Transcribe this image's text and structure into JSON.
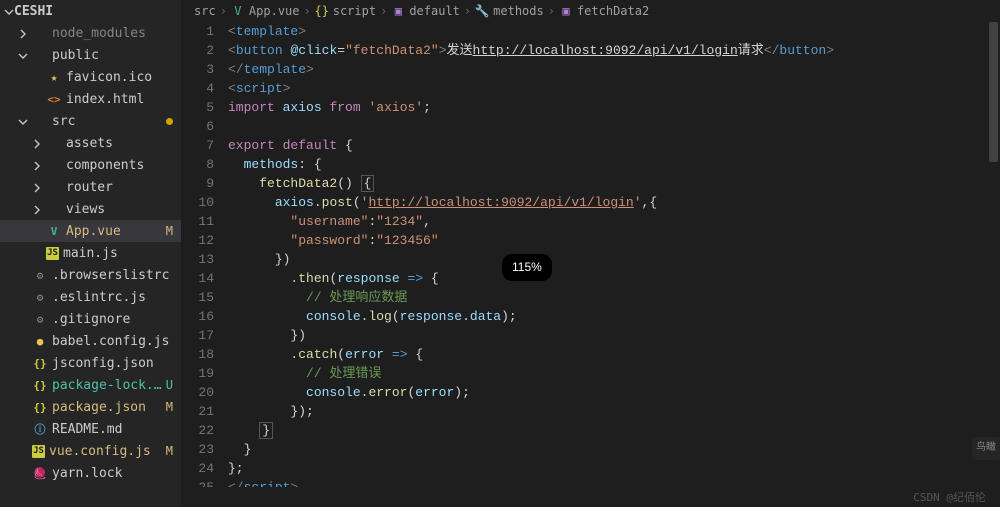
{
  "explorer": {
    "root": "CESHI",
    "items": [
      {
        "indent": 1,
        "arrow": "right",
        "icon": "folder",
        "label": "node_modules",
        "dim": true
      },
      {
        "indent": 1,
        "arrow": "down",
        "icon": "folder",
        "label": "public"
      },
      {
        "indent": 2,
        "arrow": "",
        "icon": "star",
        "label": "favicon.ico",
        "iconColor": "ic-yellow"
      },
      {
        "indent": 2,
        "arrow": "",
        "icon": "html",
        "label": "index.html",
        "iconColor": "ic-orange"
      },
      {
        "indent": 1,
        "arrow": "down",
        "icon": "folder",
        "label": "src",
        "gitDot": true
      },
      {
        "indent": 2,
        "arrow": "right",
        "icon": "folder",
        "label": "assets"
      },
      {
        "indent": 2,
        "arrow": "right",
        "icon": "folder",
        "label": "components"
      },
      {
        "indent": 2,
        "arrow": "right",
        "icon": "folder",
        "label": "router"
      },
      {
        "indent": 2,
        "arrow": "right",
        "icon": "folder",
        "label": "views"
      },
      {
        "indent": 2,
        "arrow": "",
        "icon": "vue",
        "label": "App.vue",
        "iconColor": "ic-green",
        "status": "M",
        "statusClass": "mod",
        "selected": true
      },
      {
        "indent": 2,
        "arrow": "",
        "icon": "js",
        "label": "main.js",
        "iconColor": "ic-js"
      },
      {
        "indent": 1,
        "arrow": "",
        "icon": "gear",
        "label": ".browserslistrc",
        "iconColor": "ic-gear"
      },
      {
        "indent": 1,
        "arrow": "",
        "icon": "gear",
        "label": ".eslintrc.js",
        "iconColor": "ic-gear"
      },
      {
        "indent": 1,
        "arrow": "",
        "icon": "gear",
        "label": ".gitignore",
        "iconColor": "ic-gear"
      },
      {
        "indent": 1,
        "arrow": "",
        "icon": "babel",
        "label": "babel.config.js",
        "iconColor": "ic-yellow"
      },
      {
        "indent": 1,
        "arrow": "",
        "icon": "json",
        "label": "jsconfig.json",
        "iconColor": "ic-json"
      },
      {
        "indent": 1,
        "arrow": "",
        "icon": "json",
        "label": "package-lock.json",
        "iconColor": "ic-json",
        "status": "U",
        "statusClass": ""
      },
      {
        "indent": 1,
        "arrow": "",
        "icon": "json",
        "label": "package.json",
        "iconColor": "ic-json",
        "status": "M",
        "statusClass": "mod"
      },
      {
        "indent": 1,
        "arrow": "",
        "icon": "info",
        "label": "README.md",
        "iconColor": "ic-md"
      },
      {
        "indent": 1,
        "arrow": "",
        "icon": "js",
        "label": "vue.config.js",
        "iconColor": "ic-js",
        "status": "M",
        "statusClass": "mod"
      },
      {
        "indent": 1,
        "arrow": "",
        "icon": "yarn",
        "label": "yarn.lock",
        "iconColor": "ic-blue"
      }
    ]
  },
  "breadcrumb": [
    {
      "icon": "",
      "label": "src"
    },
    {
      "icon": "vue",
      "label": "App.vue"
    },
    {
      "icon": "braces",
      "label": "script"
    },
    {
      "icon": "cube",
      "label": "default"
    },
    {
      "icon": "wrench",
      "label": "methods"
    },
    {
      "icon": "cube",
      "label": "fetchData2"
    }
  ],
  "code": {
    "startLine": 1,
    "lines": [
      [
        [
          "t-tag",
          "<"
        ],
        [
          "t-name",
          "template"
        ],
        [
          "t-tag",
          ">"
        ]
      ],
      [
        [
          "t-tag",
          "<"
        ],
        [
          "t-name",
          "button"
        ],
        [
          "",
          " "
        ],
        [
          "t-attr",
          "@click"
        ],
        [
          "t-punc",
          "="
        ],
        [
          "t-str",
          "\"fetchData2\""
        ],
        [
          "t-tag",
          ">"
        ],
        [
          "t-white",
          "发送"
        ],
        [
          "t-white t-us",
          "http://localhost:9092/api/v1/login"
        ],
        [
          "t-white",
          "请求"
        ],
        [
          "t-tag",
          "</"
        ],
        [
          "t-name",
          "button"
        ],
        [
          "t-tag",
          ">"
        ]
      ],
      [
        [
          "t-tag",
          "</"
        ],
        [
          "t-name",
          "template"
        ],
        [
          "t-tag",
          ">"
        ]
      ],
      [
        [
          "t-tag",
          "<"
        ],
        [
          "t-name",
          "script"
        ],
        [
          "t-tag",
          ">"
        ]
      ],
      [
        [
          "t-kw",
          "import"
        ],
        [
          "",
          " "
        ],
        [
          "t-var",
          "axios"
        ],
        [
          "",
          " "
        ],
        [
          "t-kw",
          "from"
        ],
        [
          "",
          " "
        ],
        [
          "t-str",
          "'axios'"
        ],
        [
          "t-punc",
          ";"
        ]
      ],
      [],
      [
        [
          "t-kw",
          "export"
        ],
        [
          "",
          " "
        ],
        [
          "t-kw",
          "default"
        ],
        [
          "",
          " "
        ],
        [
          "t-punc",
          "{"
        ]
      ],
      [
        [
          "",
          "  "
        ],
        [
          "t-var",
          "methods"
        ],
        [
          "t-punc",
          ":"
        ],
        [
          "",
          " "
        ],
        [
          "t-punc",
          "{"
        ]
      ],
      [
        [
          "",
          "    "
        ],
        [
          "t-fn",
          "fetchData2"
        ],
        [
          "t-punc",
          "()"
        ],
        [
          "",
          " "
        ],
        [
          "t-punc box-hi",
          "{"
        ]
      ],
      [
        [
          "",
          "      "
        ],
        [
          "t-var",
          "axios"
        ],
        [
          "t-punc",
          "."
        ],
        [
          "t-fn",
          "post"
        ],
        [
          "t-punc",
          "("
        ],
        [
          "t-str",
          "'"
        ],
        [
          "t-str t-us",
          "http://localhost:9092/api/v1/login"
        ],
        [
          "t-str",
          "'"
        ],
        [
          "t-punc",
          ",{"
        ]
      ],
      [
        [
          "",
          "        "
        ],
        [
          "t-str",
          "\"username\""
        ],
        [
          "t-punc",
          ":"
        ],
        [
          "t-str",
          "\"1234\""
        ],
        [
          "t-punc",
          ","
        ]
      ],
      [
        [
          "",
          "        "
        ],
        [
          "t-str",
          "\"password\""
        ],
        [
          "t-punc",
          ":"
        ],
        [
          "t-str",
          "\"123456\""
        ]
      ],
      [
        [
          "",
          "      "
        ],
        [
          "t-punc",
          "})"
        ]
      ],
      [
        [
          "",
          "        "
        ],
        [
          "t-punc",
          "."
        ],
        [
          "t-fn",
          "then"
        ],
        [
          "t-punc",
          "("
        ],
        [
          "t-var",
          "response"
        ],
        [
          "",
          " "
        ],
        [
          "t-kw2",
          "=>"
        ],
        [
          "",
          " "
        ],
        [
          "t-punc",
          "{"
        ]
      ],
      [
        [
          "",
          "          "
        ],
        [
          "t-cm",
          "// 处理响应数据"
        ]
      ],
      [
        [
          "",
          "          "
        ],
        [
          "t-var",
          "console"
        ],
        [
          "t-punc",
          "."
        ],
        [
          "t-fn",
          "log"
        ],
        [
          "t-punc",
          "("
        ],
        [
          "t-var",
          "response"
        ],
        [
          "t-punc",
          "."
        ],
        [
          "t-var",
          "data"
        ],
        [
          "t-punc",
          ");"
        ]
      ],
      [
        [
          "",
          "        "
        ],
        [
          "t-punc",
          "})"
        ]
      ],
      [
        [
          "",
          "        "
        ],
        [
          "t-punc",
          "."
        ],
        [
          "t-fn",
          "catch"
        ],
        [
          "t-punc",
          "("
        ],
        [
          "t-var",
          "error"
        ],
        [
          "",
          " "
        ],
        [
          "t-kw2",
          "=>"
        ],
        [
          "",
          " "
        ],
        [
          "t-punc",
          "{"
        ]
      ],
      [
        [
          "",
          "          "
        ],
        [
          "t-cm",
          "// 处理错误"
        ]
      ],
      [
        [
          "",
          "          "
        ],
        [
          "t-var",
          "console"
        ],
        [
          "t-punc",
          "."
        ],
        [
          "t-fn",
          "error"
        ],
        [
          "t-punc",
          "("
        ],
        [
          "t-var",
          "error"
        ],
        [
          "t-punc",
          ");"
        ]
      ],
      [
        [
          "",
          "        "
        ],
        [
          "t-punc",
          "});"
        ]
      ],
      [
        [
          "",
          "    "
        ],
        [
          "t-punc box-hi",
          "}"
        ]
      ],
      [
        [
          "",
          "  "
        ],
        [
          "t-punc",
          "}"
        ]
      ],
      [
        [
          "t-punc",
          "};"
        ]
      ],
      [
        [
          "t-tag",
          "</"
        ],
        [
          "t-name",
          "script"
        ],
        [
          "t-tag",
          ">"
        ]
      ]
    ]
  },
  "zoom": "115%",
  "footerRight": "CSDN @纪佰伦",
  "minimapLabel": "鸟瞰"
}
